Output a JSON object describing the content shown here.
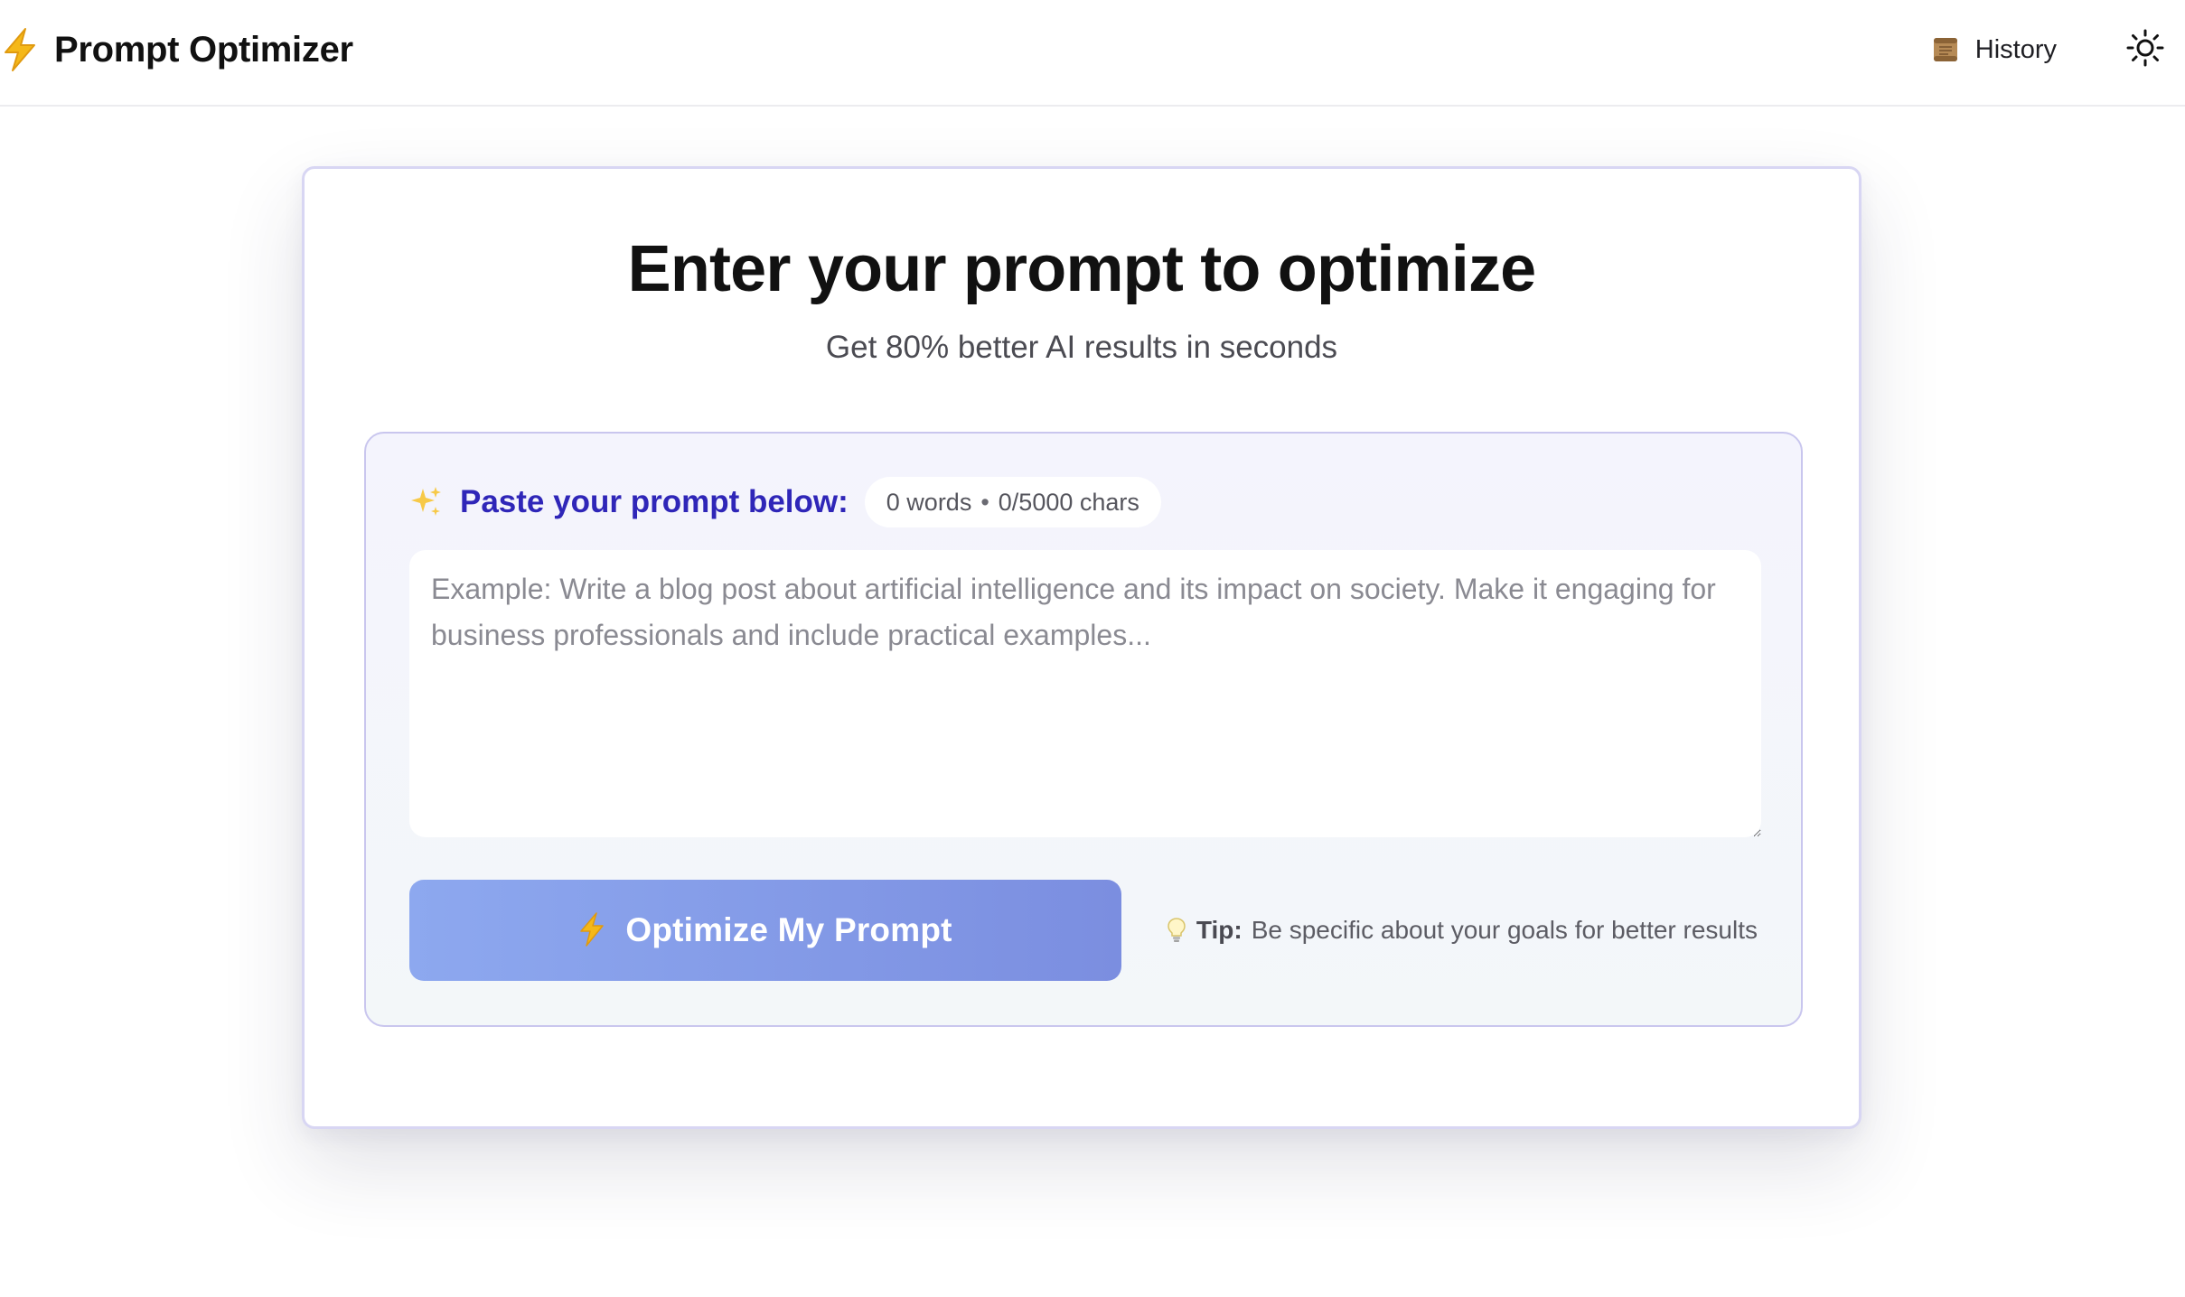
{
  "header": {
    "brand_icon": "lightning-icon",
    "title": "Prompt Optimizer",
    "history_icon": "scroll-icon",
    "history_label": "History",
    "theme_icon": "sun-icon"
  },
  "main": {
    "title": "Enter your prompt to optimize",
    "subtitle": "Get 80% better AI results in seconds",
    "panel": {
      "sparkle_icon": "sparkles-icon",
      "label": "Paste your prompt below:",
      "counter": {
        "words": "0 words",
        "separator": "•",
        "chars": "0/5000 chars"
      },
      "textarea": {
        "value": "",
        "placeholder": "Example: Write a blog post about artificial intelligence and its impact on society. Make it engaging for business professionals and include practical examples..."
      },
      "button": {
        "icon": "lightning-icon",
        "label": "Optimize My Prompt"
      },
      "tip": {
        "icon": "lightbulb-icon",
        "label": "Tip:",
        "text": "Be specific about your goals for better results"
      }
    }
  },
  "colors": {
    "accent_label": "#2f26b8",
    "button_start": "#8da8ef",
    "button_end": "#7b8ee0",
    "lightning": "#f2b21b",
    "panel_border": "#c9c6ee"
  }
}
